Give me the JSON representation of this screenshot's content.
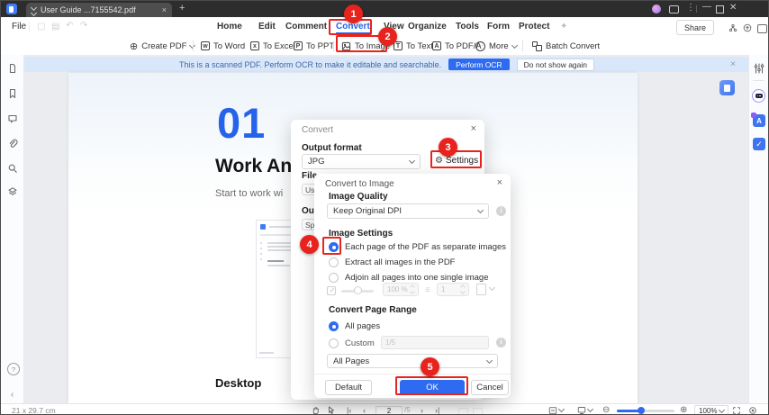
{
  "colors": {
    "accent": "#2f6bf0",
    "annotation_red": "#e8231d",
    "notification_bg": "#d9e7fb",
    "convert_link": "#2563eb"
  },
  "titlebar": {
    "tab_title": "User Guide ...7155542.pdf"
  },
  "menubar": {
    "file": "File",
    "items": [
      "Home",
      "Edit",
      "Comment",
      "Convert",
      "View",
      "Organize",
      "Tools",
      "Form",
      "Protect"
    ],
    "share": "Share"
  },
  "toolbar": {
    "items": [
      "Create PDF",
      "To Word",
      "To Excel",
      "To PPT",
      "To Image",
      "To Text",
      "To PDF/A",
      "More",
      "Batch Convert"
    ]
  },
  "notification": {
    "message": "This is a scanned PDF. Perform OCR to make it editable and searchable.",
    "ocr_button": "Perform OCR",
    "dismiss_button": "Do not show again"
  },
  "page": {
    "chapter_number": "01",
    "title": "Work Anyt",
    "subtitle": "Start to work wi",
    "caption": "Desktop"
  },
  "convert_dialog": {
    "title": "Convert",
    "output_format_label": "Output format",
    "output_format_value": "JPG",
    "settings_label": "Settings",
    "clipped_labels": [
      "File",
      "Use",
      "Outp",
      "Spe"
    ]
  },
  "image_dialog": {
    "title": "Convert to Image",
    "image_quality_label": "Image Quality",
    "image_quality_value": "Keep Original DPI",
    "image_settings_label": "Image Settings",
    "options": [
      "Each page of the PDF as separate images",
      "Extract all images in the PDF",
      "Adjoin all pages into one single image"
    ],
    "scale_value": "100 %",
    "adjoin_value": "1",
    "page_range_label": "Convert Page Range",
    "all_pages_label": "All pages",
    "custom_label": "Custom",
    "custom_placeholder": "1/5",
    "pages_dropdown_value": "All Pages",
    "default_button": "Default",
    "ok_button": "OK",
    "cancel_button": "Cancel"
  },
  "annotations": {
    "steps": [
      "1",
      "2",
      "3",
      "4",
      "5"
    ]
  },
  "statusbar": {
    "page_size": "21 x 29.7 cm",
    "current_page": "2",
    "total_pages": "/5",
    "zoom_level": "100%"
  }
}
